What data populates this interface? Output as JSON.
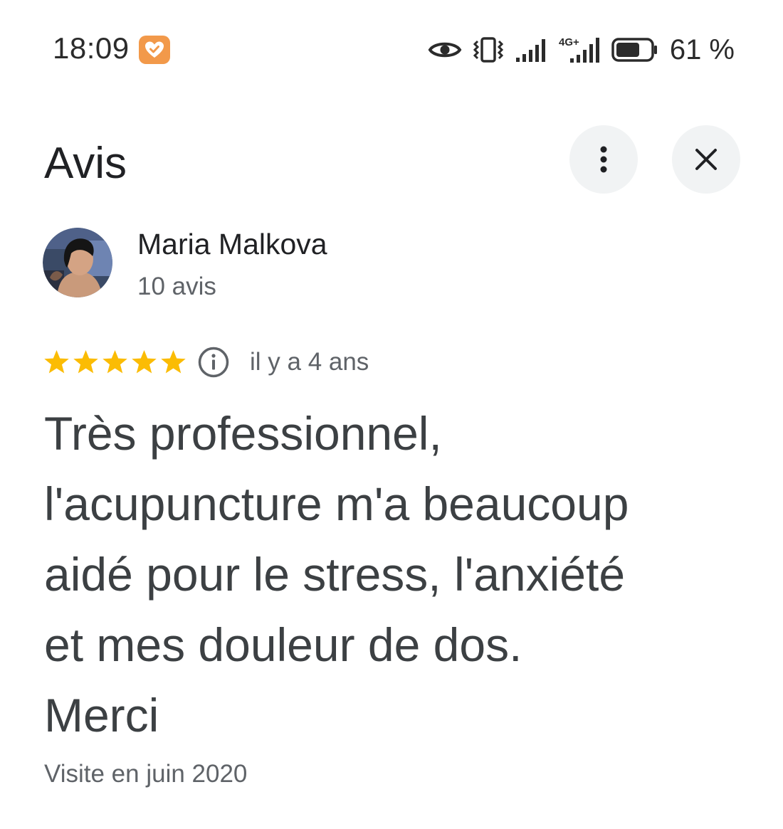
{
  "status_bar": {
    "time": "18:09",
    "network_label": "4G+",
    "battery_percent": "61 %",
    "icons": [
      "app-heart-badge-icon",
      "eye-icon",
      "vibrate-icon",
      "signal-icon",
      "signal-4g-icon",
      "battery-icon"
    ]
  },
  "header": {
    "title": "Avis",
    "more_icon": "more-vert-icon",
    "close_icon": "close-icon"
  },
  "review": {
    "reviewer_name": "Maria Malkova",
    "reviewer_review_count": "10 avis",
    "rating": 5,
    "rating_max": 5,
    "relative_date": "il y a 4 ans",
    "text": "Très professionnel,\nl'acupuncture m'a beaucoup\naidé pour le stress, l'anxiété\net mes douleur de dos.\nMerci",
    "visit_date": "Visite en juin 2020"
  },
  "colors": {
    "star": "#fbbc04",
    "badge": "#f2994a",
    "button_bg": "#f1f3f4",
    "secondary_text": "#5f6368"
  }
}
